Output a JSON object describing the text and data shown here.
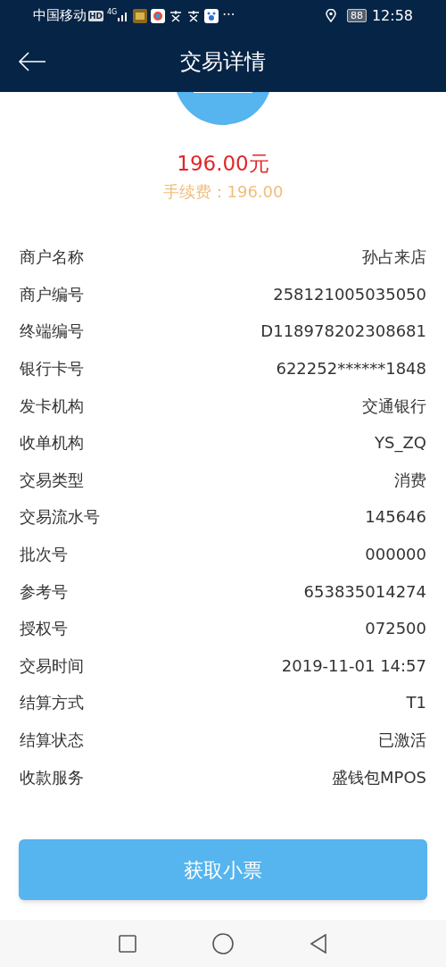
{
  "status_bar": {
    "carrier": "中国移动",
    "hd": "HD",
    "network": "4G",
    "more": "···",
    "battery": "88",
    "time": "12:58"
  },
  "header": {
    "title": "交易详情"
  },
  "amount": "196.00元",
  "fee": "手续费：196.00",
  "details": [
    {
      "label": "商户名称",
      "value": "孙占来店"
    },
    {
      "label": "商户编号",
      "value": "258121005035050"
    },
    {
      "label": "终端编号",
      "value": "D118978202308681"
    },
    {
      "label": "银行卡号",
      "value": "622252******1848"
    },
    {
      "label": "发卡机构",
      "value": "交通银行"
    },
    {
      "label": "收单机构",
      "value": "YS_ZQ"
    },
    {
      "label": "交易类型",
      "value": "消费"
    },
    {
      "label": "交易流水号",
      "value": "145646"
    },
    {
      "label": "批次号",
      "value": "000000"
    },
    {
      "label": "参考号",
      "value": "653835014274"
    },
    {
      "label": "授权号",
      "value": "072500"
    },
    {
      "label": "交易时间",
      "value": "2019-11-01 14:57"
    },
    {
      "label": "结算方式",
      "value": "T1"
    },
    {
      "label": "结算状态",
      "value": "已激活"
    },
    {
      "label": "收款服务",
      "value": "盛钱包MPOS"
    }
  ],
  "button": "获取小票"
}
